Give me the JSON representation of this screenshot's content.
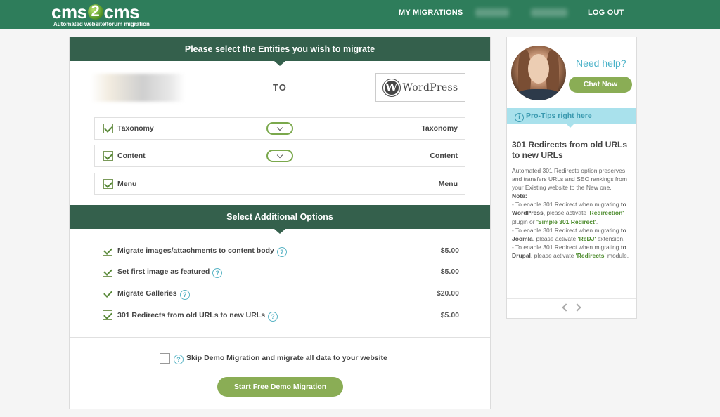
{
  "header": {
    "logo_main_left": "cms",
    "logo_main_right": "cms",
    "logo_sub": "Automated website/forum migration",
    "nav_my_migrations": "MY MIGRATIONS",
    "nav_log_out": "LOG OUT"
  },
  "entities_section": {
    "title": "Please select the Entities you wish to migrate",
    "to_label": "TO",
    "target_logo_letter": "W",
    "target_logo_text": "WordPress",
    "rows": [
      {
        "label": "Taxonomy",
        "target": "Taxonomy",
        "checked": true
      },
      {
        "label": "Content",
        "target": "Content",
        "checked": true
      },
      {
        "label": "Menu",
        "target": "Menu",
        "checked": true
      }
    ]
  },
  "options_section": {
    "title": "Select Additional Options",
    "options": [
      {
        "label": "Migrate images/attachments to content body",
        "price": "$5.00",
        "checked": true
      },
      {
        "label": "Set first image as featured",
        "price": "$5.00",
        "checked": true
      },
      {
        "label": "Migrate Galleries",
        "price": "$20.00",
        "checked": true
      },
      {
        "label": "301 Redirects from old URLs to new URLs",
        "price": "$5.00",
        "checked": true
      }
    ],
    "help_glyph": "?"
  },
  "skip_demo": {
    "label": "Skip Demo Migration and migrate all data to your website",
    "checked": false
  },
  "start_button": "Start Free Demo Migration",
  "sidebar": {
    "need_help": "Need help?",
    "chat_now": "Chat Now",
    "protips_label": "Pro-Tips right here",
    "info_glyph": "i",
    "tip_title": "301 Redirects from old URLs to new URLs",
    "tip_intro": "Automated 301 Redirects option preserves and transfers URLs and SEO rankings from your Existing website to the New one.",
    "note_label": "Note:",
    "wp_prefix": "- To enable 301 Redirect when migrating ",
    "wp_target": "to WordPress",
    "wp_mid": ", please activate ",
    "wp_plugin1": "'Redirection'",
    "wp_or": " plugin or ",
    "wp_plugin2": "'Simple 301 Redirect'",
    "wp_end": ".",
    "joomla_prefix": "- To enable 301 Redirect when migrating ",
    "joomla_target": "to Joomla",
    "joomla_mid": ", please activate ",
    "joomla_ext": "'ReDJ'",
    "joomla_end": " extension.",
    "drupal_prefix": "- To enable 301 Redirect when migrating ",
    "drupal_target": "to Drupal",
    "drupal_mid": ", please activate ",
    "drupal_mod": "'Redirects'",
    "drupal_end": " module."
  },
  "colors": {
    "header_green": "#2e7d5b",
    "section_header": "#34604c",
    "button_green": "#8aad55",
    "help_blue": "#4cb3c9",
    "protips_bg": "#a9e1ec"
  }
}
